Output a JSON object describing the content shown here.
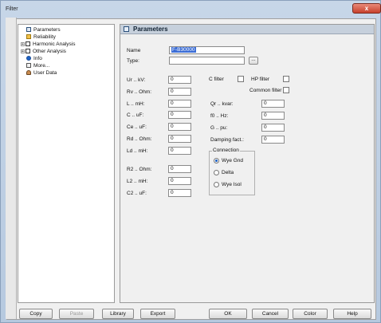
{
  "window": {
    "title": "Filter",
    "close_label": "x"
  },
  "tree": {
    "items": [
      {
        "label": "Parameters",
        "icon": "parameters-icon",
        "expander": ""
      },
      {
        "label": "Reliability",
        "icon": "reliability-icon",
        "expander": ""
      },
      {
        "label": "Harmonic Analysis",
        "icon": "harmonic-icon",
        "expander": "+"
      },
      {
        "label": "Other Analysis",
        "icon": "other-analysis-icon",
        "expander": "+"
      },
      {
        "label": "Info",
        "icon": "info-icon",
        "expander": ""
      },
      {
        "label": "More...",
        "icon": "more-icon",
        "expander": ""
      },
      {
        "label": "User Data",
        "icon": "user-data-icon",
        "expander": ""
      }
    ]
  },
  "panel": {
    "title": "Parameters"
  },
  "form": {
    "name_label": "Name",
    "name_value": "F-B30000",
    "type_label": "Type:",
    "type_value": "",
    "browse_label": "...",
    "ur_label": "Ur .. kV:",
    "ur_value": "0",
    "rv_label": "Rv .. Ohm:",
    "rv_value": "0",
    "l_label": "L .. mH:",
    "l_value": "0",
    "c_label": "C .. uF:",
    "c_value": "0",
    "ce_label": "Ce .. uF:",
    "ce_value": "0",
    "rd_label": "Rd .. Ohm:",
    "rd_value": "0",
    "ld_label": "Ld .. mH:",
    "ld_value": "0",
    "r2_label": "R2 .. Ohm:",
    "r2_value": "0",
    "l2_label": "L2 .. mH:",
    "l2_value": "0",
    "c2_label": "C2 .. uF:",
    "c2_value": "0",
    "cfilter_label": "C filter",
    "hpfilter_label": "HP filter",
    "common_label": "Common filter",
    "qr_label": "Qr .. kvar:",
    "qr_value": "0",
    "f0_label": "f0 .. Hz:",
    "f0_value": "0",
    "g_label": "G .. pu:",
    "g_value": "0",
    "damp_label": "Damping fact.:",
    "damp_value": "0",
    "connection_label": "Connection",
    "conn_options": [
      "Wye Gnd",
      "Delta",
      "Wye Isol"
    ]
  },
  "buttons": {
    "copy": "Copy",
    "paste": "Paste",
    "library": "Library",
    "export": "Export",
    "ok": "OK",
    "cancel": "Cancel",
    "color": "Color",
    "help": "Help"
  }
}
